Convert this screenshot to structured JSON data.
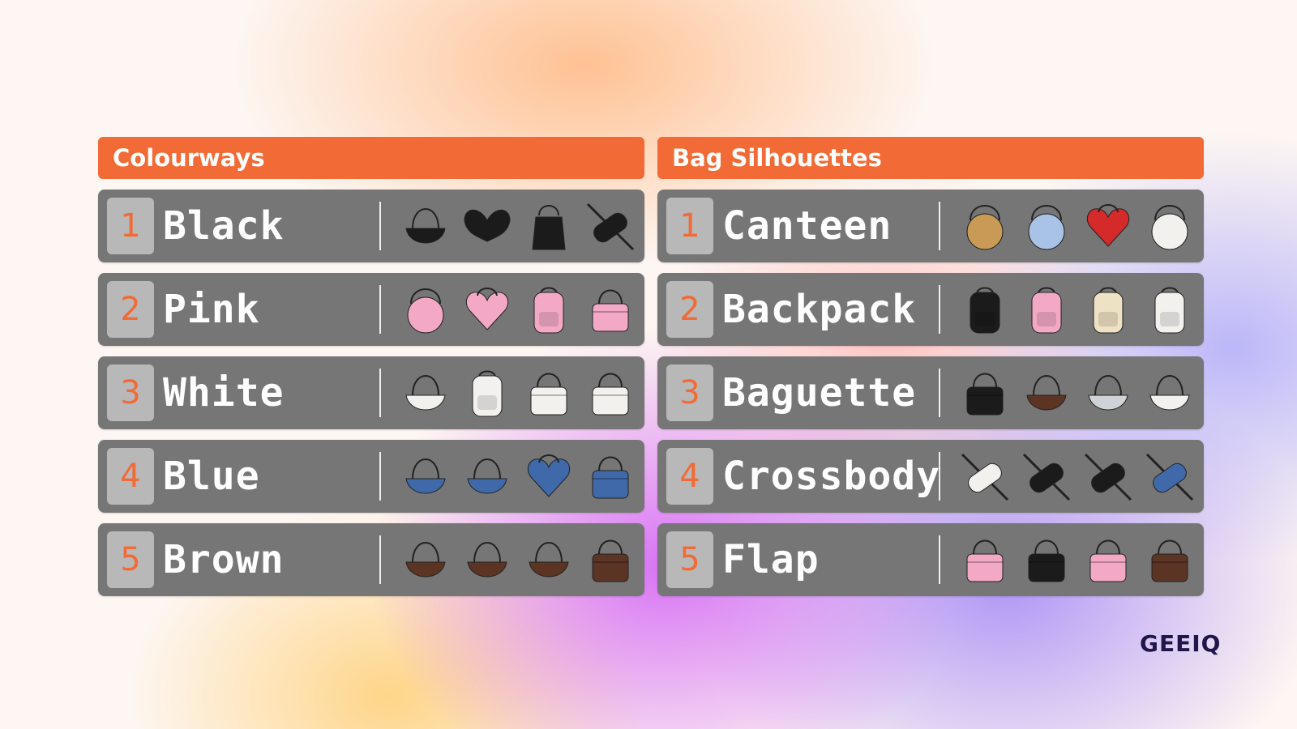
{
  "panels": [
    {
      "title": "Colourways",
      "rows": [
        {
          "number": "1",
          "label": "Black",
          "bags": [
            "black-baguette-bag",
            "black-bat-wing-bag",
            "black-bucket-bag",
            "black-crossbody-bag"
          ]
        },
        {
          "number": "2",
          "label": "Pink",
          "bags": [
            "pink-ball-bag",
            "pink-heart-bag",
            "pink-bow-backpack",
            "pink-quilted-bag"
          ]
        },
        {
          "number": "3",
          "label": "White",
          "bags": [
            "white-shoulder-bag",
            "white-bow-backpack",
            "white-bow-tote",
            "white-quilted-tote"
          ]
        },
        {
          "number": "4",
          "label": "Blue",
          "bags": [
            "blue-denim-bow-bag",
            "blue-denim-chain-bag",
            "blue-heart-bag",
            "blue-denim-tote"
          ]
        },
        {
          "number": "5",
          "label": "Brown",
          "bags": [
            "brown-ruched-bag",
            "brown-shoulder-bag",
            "brown-hobo-bag",
            "brown-flap-bag"
          ]
        }
      ]
    },
    {
      "title": "Bag Silhouettes",
      "rows": [
        {
          "number": "1",
          "label": "Canteen",
          "bags": [
            "rattan-canteen-bag",
            "butterfly-canteen-bag",
            "red-heart-canteen-bag",
            "white-bow-canteen-bag"
          ]
        },
        {
          "number": "2",
          "label": "Backpack",
          "bags": [
            "black-backpack",
            "pink-backpack",
            "cream-backpack",
            "black-white-backpack"
          ]
        },
        {
          "number": "3",
          "label": "Baguette",
          "bags": [
            "black-quilted-baguette",
            "brown-baguette",
            "silver-baguette",
            "white-baguette"
          ]
        },
        {
          "number": "4",
          "label": "Crossbody",
          "bags": [
            "white-crossbody",
            "black-floral-crossbody",
            "black-crossbody",
            "blue-crossbody"
          ]
        },
        {
          "number": "5",
          "label": "Flap",
          "bags": [
            "pink-pearl-flap",
            "black-leopard-flap",
            "pink-chain-flap",
            "black-brown-flap"
          ]
        }
      ]
    }
  ],
  "brand": {
    "logo": "GEEIQ"
  },
  "colors": {
    "accent": "#f26a35",
    "row": "#767676",
    "badge": "#b8b8b8",
    "logo": "#20164a"
  }
}
